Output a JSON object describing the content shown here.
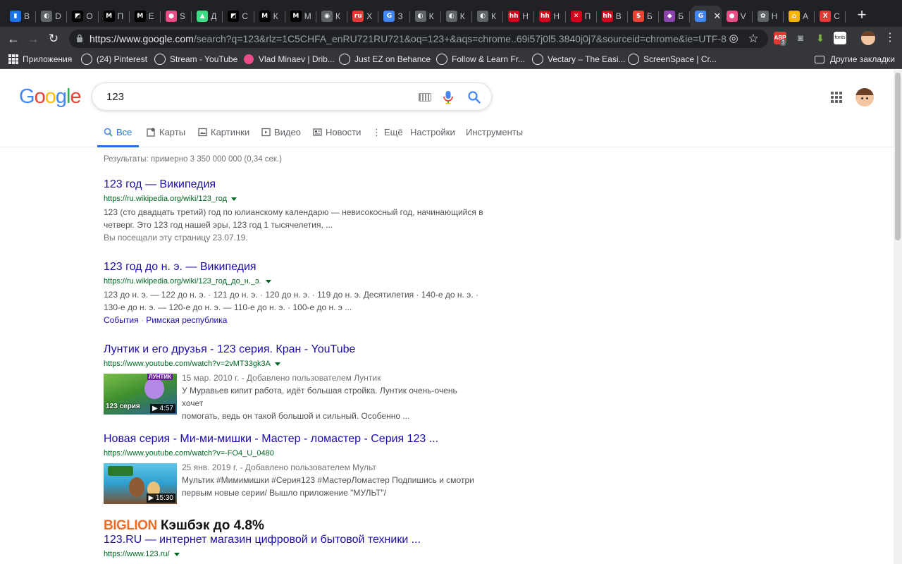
{
  "browser": {
    "tabs": [
      {
        "label": "В",
        "color": "#1a73e8",
        "glyph": "▮",
        "active": false
      },
      {
        "label": "D",
        "color": "#5f6368",
        "glyph": "◐",
        "active": false
      },
      {
        "label": "О",
        "color": "#000000",
        "glyph": "◩",
        "active": false
      },
      {
        "label": "П",
        "color": "#000000",
        "glyph": "M",
        "active": false
      },
      {
        "label": "E",
        "color": "#000000",
        "glyph": "M",
        "active": false
      },
      {
        "label": "S",
        "color": "#ea4c89",
        "glyph": "●",
        "active": false
      },
      {
        "label": "Д",
        "color": "#3ddc84",
        "glyph": "▲",
        "active": false
      },
      {
        "label": "С",
        "color": "#000000",
        "glyph": "◩",
        "active": false
      },
      {
        "label": "К",
        "color": "#000000",
        "glyph": "M",
        "active": false
      },
      {
        "label": "М",
        "color": "#000000",
        "glyph": "M",
        "active": false
      },
      {
        "label": "К",
        "color": "#5f6368",
        "glyph": "◉",
        "active": false
      },
      {
        "label": "Х",
        "color": "#e53935",
        "glyph": "ru",
        "active": false
      },
      {
        "label": "З",
        "color": "#4285f4",
        "glyph": "G",
        "active": false
      },
      {
        "label": "К",
        "color": "#5f6368",
        "glyph": "◐",
        "active": false
      },
      {
        "label": "К",
        "color": "#5f6368",
        "glyph": "◐",
        "active": false
      },
      {
        "label": "К",
        "color": "#5f6368",
        "glyph": "◐",
        "active": false
      },
      {
        "label": "Н",
        "color": "#d6001c",
        "glyph": "hh",
        "active": false
      },
      {
        "label": "Н",
        "color": "#d6001c",
        "glyph": "hh",
        "active": false
      },
      {
        "label": "П",
        "color": "#d6001c",
        "glyph": "✕",
        "active": false
      },
      {
        "label": "В",
        "color": "#d6001c",
        "glyph": "hh",
        "active": false
      },
      {
        "label": "Б",
        "color": "#ea4335",
        "glyph": "$",
        "active": false
      },
      {
        "label": "Б",
        "color": "#8e44ad",
        "glyph": "◆",
        "active": false
      },
      {
        "label": "",
        "color": "#4285f4",
        "glyph": "G",
        "active": true
      },
      {
        "label": "V",
        "color": "#ea4c89",
        "glyph": "●",
        "active": false
      },
      {
        "label": "Н",
        "color": "#5f6368",
        "glyph": "✿",
        "active": false
      },
      {
        "label": "А",
        "color": "#f5b400",
        "glyph": "⌂",
        "active": false
      },
      {
        "label": "С",
        "color": "#e53935",
        "glyph": "Х",
        "active": false
      }
    ],
    "url_host": "https://www.google.com",
    "url_path": "/search?q=123&rlz=1C5CHFA_enRU721RU721&oq=123+&aqs=chrome..69i57j0l5.3840j0j7&sourceid=chrome&ie=UTF-8",
    "ext_badge": "3",
    "ext_fonts": "fonts",
    "bookmarks": [
      {
        "label": "Приложения",
        "icon": "grid"
      },
      {
        "label": "(24) Pinterest",
        "icon": "globe"
      },
      {
        "label": "Stream - YouTube",
        "icon": "globe"
      },
      {
        "label": "Vlad Minaev | Drib...",
        "icon": "dribbble"
      },
      {
        "label": "Just EZ on Behance",
        "icon": "globe"
      },
      {
        "label": "Follow & Learn Fr...",
        "icon": "globe"
      },
      {
        "label": "Vectary – The Easi...",
        "icon": "globe"
      },
      {
        "label": "ScreenSpace | Cr...",
        "icon": "globe"
      }
    ],
    "other_bookmarks": "Другие закладки"
  },
  "google": {
    "logo": [
      "G",
      "o",
      "o",
      "g",
      "l",
      "e"
    ],
    "query": "123",
    "tabs": [
      {
        "label": "Все",
        "active": true
      },
      {
        "label": "Карты",
        "active": false
      },
      {
        "label": "Картинки",
        "active": false
      },
      {
        "label": "Видео",
        "active": false
      },
      {
        "label": "Новости",
        "active": false
      },
      {
        "label": "Ещё",
        "active": false
      },
      {
        "label": "Настройки",
        "active": false
      },
      {
        "label": "Инструменты",
        "active": false
      }
    ],
    "stats": "Результаты: примерно 3 350 000 000 (0,34 сек.)",
    "results": [
      {
        "title": "123 год — Википедия",
        "url": "https://ru.wikipedia.org/wiki/123_год",
        "snippet_lines": [
          "123 (сто двадцать третий) год по юлианскому календарю — невисокосный год, начинающийся в",
          "четверг. Это 123 год нашей эры, 123 год 1 тысячелетия, ..."
        ],
        "visited": "Вы посещали эту страницу 23.07.19."
      },
      {
        "title": "123 год до н. э. — Википедия",
        "url": "https://ru.wikipedia.org/wiki/123_год_до_н._э.",
        "snippet_lines": [
          "123 до н. э. — 122 до н. э. · 121 до н. э. · 120 до н. э. · 119 до н. э. Десятилетия · 140-е до н. э. ·",
          "130-е до н. э. — 120-е до н. э. — 110-е до н. э. · 100-е до н. э ..."
        ],
        "links": [
          "События",
          "Римская республика"
        ]
      },
      {
        "title": "Лунтик и его друзья - 123 серия. Кран - YouTube",
        "url": "https://www.youtube.com/watch?v=2vMT33gk3A",
        "meta": "15 мар. 2010 г. - Добавлено пользователем Лунтик",
        "snippet_lines": [
          "У Муравьев кипит работа, идёт большая стройка. Лунтик очень-очень хочет",
          "помогать, ведь он такой большой и сильный. Особенно ..."
        ],
        "thumb_label": "123 серия",
        "duration": "▶ 4:57"
      },
      {
        "title": "Новая серия - Ми-ми-мишки - Мастер - ломастер - Серия 123 ...",
        "url": "https://www.youtube.com/watch?v=-FO4_U_0480",
        "meta": "25 янв. 2019 г. - Добавлено пользователем Мульт",
        "snippet_lines": [
          "Мультик #Мимимишки #Серия123 #МастерЛомастер Подпишись и смотри",
          "первым новые серии/ Вышло приложение \"МУЛЬТ\"/"
        ],
        "duration": "▶ 15:30"
      },
      {
        "title": "123.RU — интернет магазин цифровой и бытовой техники ...",
        "url": "https://www.123.ru/"
      }
    ],
    "ad": {
      "brand": "BIGLION",
      "text": " Кэшбэк до 4.8%"
    }
  }
}
